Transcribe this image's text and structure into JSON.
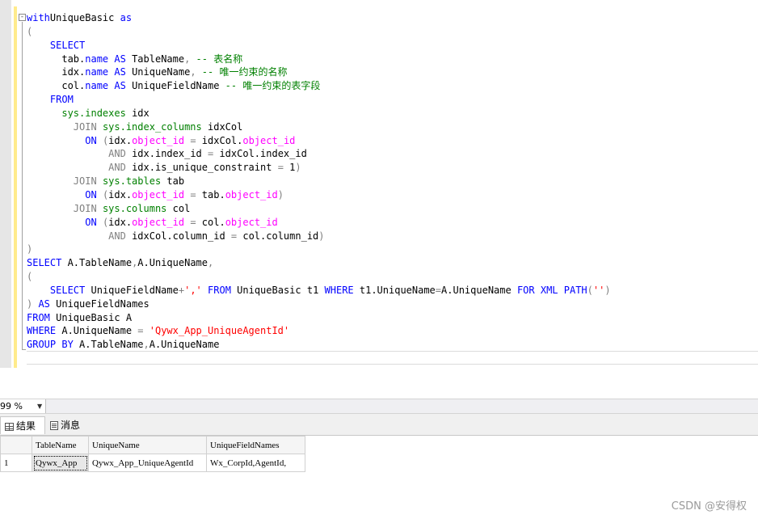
{
  "editor": {
    "fold_symbol": "-",
    "lines": [
      [
        [
          "kw",
          "with"
        ],
        [
          "",
          "UniqueBasic"
        ],
        [
          "kw",
          " as"
        ]
      ],
      [
        [
          "gr",
          "("
        ]
      ],
      [
        [
          "",
          "    "
        ],
        [
          "kw",
          "SELECT"
        ]
      ],
      [
        [
          "",
          "      tab."
        ],
        [
          "kw",
          "name"
        ],
        [
          "kw",
          " AS"
        ],
        [
          "",
          " TableName"
        ],
        [
          "gr",
          ","
        ],
        [
          "cm",
          " -- 表名称"
        ]
      ],
      [
        [
          "",
          "      idx."
        ],
        [
          "kw",
          "name"
        ],
        [
          "kw",
          " AS"
        ],
        [
          "",
          " UniqueName"
        ],
        [
          "gr",
          ","
        ],
        [
          "cm",
          " -- 唯一约束的名称"
        ]
      ],
      [
        [
          "",
          "      col."
        ],
        [
          "kw",
          "name"
        ],
        [
          "kw",
          " AS"
        ],
        [
          "",
          " UniqueFieldName"
        ],
        [
          "cm",
          " -- 唯一约束的表字段"
        ]
      ],
      [
        [
          "",
          "    "
        ],
        [
          "kw",
          "FROM"
        ]
      ],
      [
        [
          "",
          "      "
        ],
        [
          "sv",
          "sys.indexes"
        ],
        [
          "",
          " idx"
        ]
      ],
      [
        [
          "",
          "        "
        ],
        [
          "gr",
          "JOIN"
        ],
        [
          "",
          " "
        ],
        [
          "sv",
          "sys.index_columns"
        ],
        [
          "",
          " idxCol"
        ]
      ],
      [
        [
          "",
          "          "
        ],
        [
          "kw",
          "ON"
        ],
        [
          "",
          " "
        ],
        [
          "gr",
          "("
        ],
        [
          "",
          "idx."
        ],
        [
          "mg",
          "object_id"
        ],
        [
          "",
          " "
        ],
        [
          "gr",
          "="
        ],
        [
          "",
          " idxCol."
        ],
        [
          "mg",
          "object_id"
        ]
      ],
      [
        [
          "",
          "              "
        ],
        [
          "gr",
          "AND"
        ],
        [
          "",
          " idx.index_id "
        ],
        [
          "gr",
          "="
        ],
        [
          "",
          " idxCol.index_id"
        ]
      ],
      [
        [
          "",
          "              "
        ],
        [
          "gr",
          "AND"
        ],
        [
          "",
          " idx.is_unique_constraint "
        ],
        [
          "gr",
          "="
        ],
        [
          "",
          " 1"
        ],
        [
          "gr",
          ")"
        ]
      ],
      [
        [
          "",
          "        "
        ],
        [
          "gr",
          "JOIN"
        ],
        [
          "",
          " "
        ],
        [
          "sv",
          "sys.tables"
        ],
        [
          "",
          " tab"
        ]
      ],
      [
        [
          "",
          "          "
        ],
        [
          "kw",
          "ON"
        ],
        [
          "",
          " "
        ],
        [
          "gr",
          "("
        ],
        [
          "",
          "idx."
        ],
        [
          "mg",
          "object_id"
        ],
        [
          "",
          " "
        ],
        [
          "gr",
          "="
        ],
        [
          "",
          " tab."
        ],
        [
          "mg",
          "object_id"
        ],
        [
          "gr",
          ")"
        ]
      ],
      [
        [
          "",
          "        "
        ],
        [
          "gr",
          "JOIN"
        ],
        [
          "",
          " "
        ],
        [
          "sv",
          "sys.columns"
        ],
        [
          "",
          " col"
        ]
      ],
      [
        [
          "",
          "          "
        ],
        [
          "kw",
          "ON"
        ],
        [
          "",
          " "
        ],
        [
          "gr",
          "("
        ],
        [
          "",
          "idx."
        ],
        [
          "mg",
          "object_id"
        ],
        [
          "",
          " "
        ],
        [
          "gr",
          "="
        ],
        [
          "",
          " col."
        ],
        [
          "mg",
          "object_id"
        ]
      ],
      [
        [
          "",
          "              "
        ],
        [
          "gr",
          "AND"
        ],
        [
          "",
          " idxCol.column_id "
        ],
        [
          "gr",
          "="
        ],
        [
          "",
          " col.column_id"
        ],
        [
          "gr",
          ")"
        ]
      ],
      [
        [
          "gr",
          ")"
        ]
      ],
      [
        [
          "kw",
          "SELECT"
        ],
        [
          "",
          " A.TableName"
        ],
        [
          "gr",
          ","
        ],
        [
          "",
          "A.UniqueName"
        ],
        [
          "gr",
          ","
        ]
      ],
      [
        [
          "gr",
          "("
        ]
      ],
      [
        [
          "",
          "    "
        ],
        [
          "kw",
          "SELECT"
        ],
        [
          "",
          " UniqueFieldName"
        ],
        [
          "gr",
          "+"
        ],
        [
          "st",
          "','"
        ],
        [
          "",
          " "
        ],
        [
          "kw",
          "FROM"
        ],
        [
          "",
          " UniqueBasic t1 "
        ],
        [
          "kw",
          "WHERE"
        ],
        [
          "",
          " t1.UniqueName"
        ],
        [
          "gr",
          "="
        ],
        [
          "",
          "A.UniqueName "
        ],
        [
          "kw",
          "FOR XML PATH"
        ],
        [
          "gr",
          "("
        ],
        [
          "st",
          "''"
        ],
        [
          "gr",
          ")"
        ]
      ],
      [
        [
          "gr",
          ")"
        ],
        [
          "kw",
          " AS"
        ],
        [
          "",
          " UniqueFieldNames"
        ]
      ],
      [
        [
          "kw",
          "FROM"
        ],
        [
          "",
          " UniqueBasic A"
        ]
      ],
      [
        [
          "kw",
          "WHERE"
        ],
        [
          "",
          " A.UniqueName "
        ],
        [
          "gr",
          "="
        ],
        [
          "st",
          " 'Qywx_App_UniqueAgentId'"
        ]
      ],
      [
        [
          "kw",
          "GROUP BY"
        ],
        [
          "",
          " A.TableName"
        ],
        [
          "gr",
          ","
        ],
        [
          "",
          "A.UniqueName"
        ]
      ]
    ]
  },
  "zoom": {
    "value": "99 %",
    "arrow": "▼"
  },
  "tabs": {
    "results": "结果",
    "messages": "消息"
  },
  "grid": {
    "columns": [
      "TableName",
      "UniqueName",
      "UniqueFieldNames"
    ],
    "rows": [
      {
        "num": "1",
        "cells": [
          "Qywx_App",
          "Qywx_App_UniqueAgentId",
          "Wx_CorpId,AgentId,"
        ]
      }
    ]
  },
  "watermark": "CSDN @安得权"
}
